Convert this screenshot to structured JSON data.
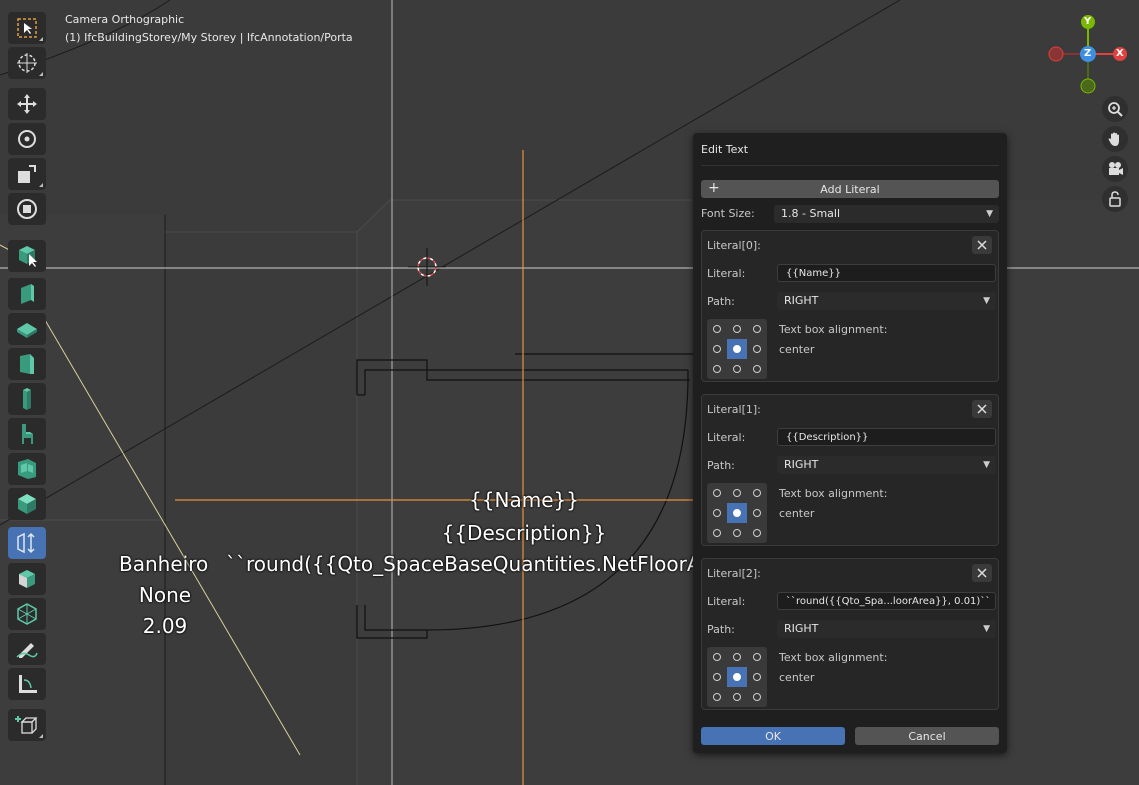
{
  "viewport": {
    "view_mode": "Camera Orthographic",
    "context": "(1) IfcBuildingStorey/My Storey | IfcAnnotation/Porta",
    "labels": {
      "name": "{{Name}}",
      "description": "{{Description}}",
      "banheiro": "Banheiro",
      "round_expr": "``round({{Qto_SpaceBaseQuantities.NetFloorA",
      "none": "None",
      "value": "2.09"
    }
  },
  "gizmo": {
    "x": "X",
    "y": "Y",
    "z": "Z"
  },
  "toolbar": {
    "tools": [
      "select-box-icon",
      "cursor-icon",
      "move-icon",
      "rotate-icon",
      "scale-icon",
      "transform-icon",
      "ifc-select-icon",
      "wall-icon",
      "slab-icon",
      "door-icon",
      "column-icon",
      "furniture-icon",
      "window-icon",
      "space-icon",
      "annotation-icon",
      "measure-icon",
      "mesh-icon",
      "pen-icon",
      "ruler-icon",
      "add-cube-icon"
    ],
    "active": "annotation-icon"
  },
  "dialog": {
    "title": "Edit Text",
    "add_literal": "Add Literal",
    "font_size_label": "Font Size:",
    "font_size_value": "1.8 - Small",
    "literals": [
      {
        "header": "Literal[0]:",
        "literal_label": "Literal:",
        "literal_value": "{{Name}}",
        "path_label": "Path:",
        "path_value": "RIGHT",
        "align_label": "Text box alignment:",
        "align_value": "center"
      },
      {
        "header": "Literal[1]:",
        "literal_label": "Literal:",
        "literal_value": "{{Description}}",
        "path_label": "Path:",
        "path_value": "RIGHT",
        "align_label": "Text box alignment:",
        "align_value": "center"
      },
      {
        "header": "Literal[2]:",
        "literal_label": "Literal:",
        "literal_value": "``round({{Qto_Spa...loorArea}}, 0.01)``",
        "path_label": "Path:",
        "path_value": "RIGHT",
        "align_label": "Text box alignment:",
        "align_value": "center"
      }
    ],
    "ok": "OK",
    "cancel": "Cancel"
  },
  "colors": {
    "background": "#3d3d3d",
    "accent": "#4772b3",
    "x_axis": "#e0413f",
    "y_axis": "#7ab800",
    "z_axis": "#3f8fe0",
    "guide_orange": "#e8913a"
  }
}
